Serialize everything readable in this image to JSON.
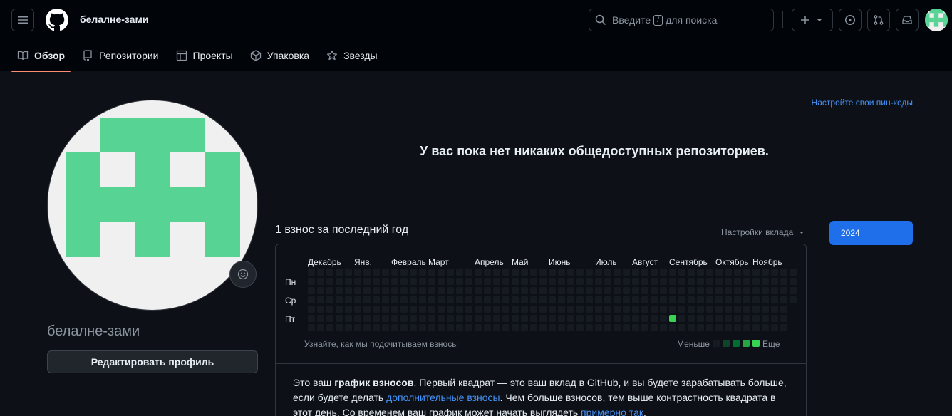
{
  "header": {
    "username": "белалне-зами",
    "search": {
      "before": "Введите",
      "key": "/",
      "after": "для поиска"
    }
  },
  "tabs": [
    {
      "label": "Обзор",
      "icon": "book-icon",
      "active": true
    },
    {
      "label": "Репозитории",
      "icon": "repo-icon"
    },
    {
      "label": "Проекты",
      "icon": "table-icon"
    },
    {
      "label": "Упаковка",
      "icon": "package-icon"
    },
    {
      "label": "Звезды",
      "icon": "star-icon"
    }
  ],
  "profile": {
    "name": "белалне-зами",
    "edit_button": "Редактировать профиль",
    "avatar_color": "#57d394"
  },
  "main": {
    "pin_link": "Настройте свои пин-коды",
    "no_repos": "У вас пока нет никаких общедоступных репозиториев."
  },
  "contributions": {
    "title": "1 взнос за последний год",
    "settings": "Настройки вклада",
    "year": "2024",
    "months": [
      "Декабрь",
      "Янв.",
      "Февраль",
      "Март",
      "Апрель",
      "Май",
      "Июнь",
      "Июль",
      "Август",
      "Сентябрь",
      "Октябрь",
      "Ноябрь"
    ],
    "days": [
      "Пн",
      "Ср",
      "Пт"
    ],
    "learn": "Узнайте, как мы подсчитываем взносы",
    "less": "Меньше",
    "more": "Еще",
    "legend_colors": [
      "#161b22",
      "#0e4429",
      "#006d32",
      "#26a641",
      "#39d353"
    ],
    "active_color": "#39d353",
    "explain": {
      "p1": "Это ваш ",
      "bold": "график взносов",
      "p2": ". Первый квадрат — это ваш вклад в GitHub, и вы будете зарабатывать больше, если будете делать ",
      "link1": "дополнительные взносы",
      "p3": ". Чем больше взносов, тем выше контрастность квадрата в этот день. Со временем ваш график может начать выглядеть ",
      "link2": "примерно так",
      "p4": "."
    }
  }
}
